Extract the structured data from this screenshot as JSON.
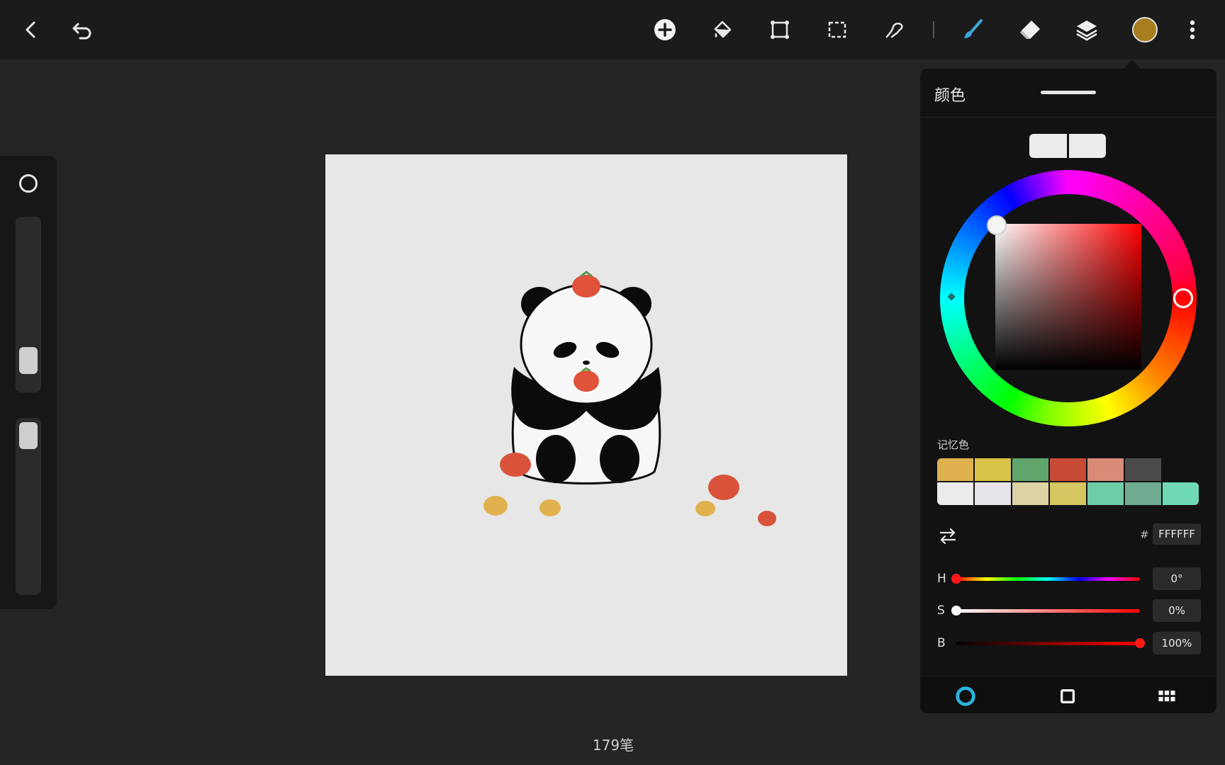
{
  "toolbar": {
    "back": "back-icon",
    "undo": "undo-icon",
    "tools": [
      "add-icon",
      "fill-bucket-icon",
      "transform-icon",
      "selection-icon",
      "smudge-icon",
      "brush-icon",
      "eraser-icon",
      "layers-icon"
    ],
    "current_color": "#a87d1e",
    "more": "more-vertical-icon"
  },
  "status": {
    "stroke_count": "179笔"
  },
  "color_panel": {
    "title": "颜色",
    "memory_label": "记忆色",
    "memory_colors_row1": [
      "#e0b24e",
      "#d8c24a",
      "#5fa56c",
      "#c64a36",
      "#d98b78",
      "#4b4b4b"
    ],
    "memory_colors_row2": [
      "#ececec",
      "#e6e4ea",
      "#ddd2a6",
      "#d4c660",
      "#6fcca8",
      "#70ac92",
      "#6fd9b6"
    ],
    "hex_prefix": "#",
    "hex_value": "FFFFFF",
    "h_label": "H",
    "h_value": "0°",
    "s_label": "S",
    "s_value": "0%",
    "b_label": "B",
    "b_value": "100%",
    "hue": 0,
    "saturation": 0,
    "brightness": 1,
    "tabs": [
      "wheel-tab-icon",
      "square-tab-icon",
      "palette-grid-icon"
    ]
  }
}
